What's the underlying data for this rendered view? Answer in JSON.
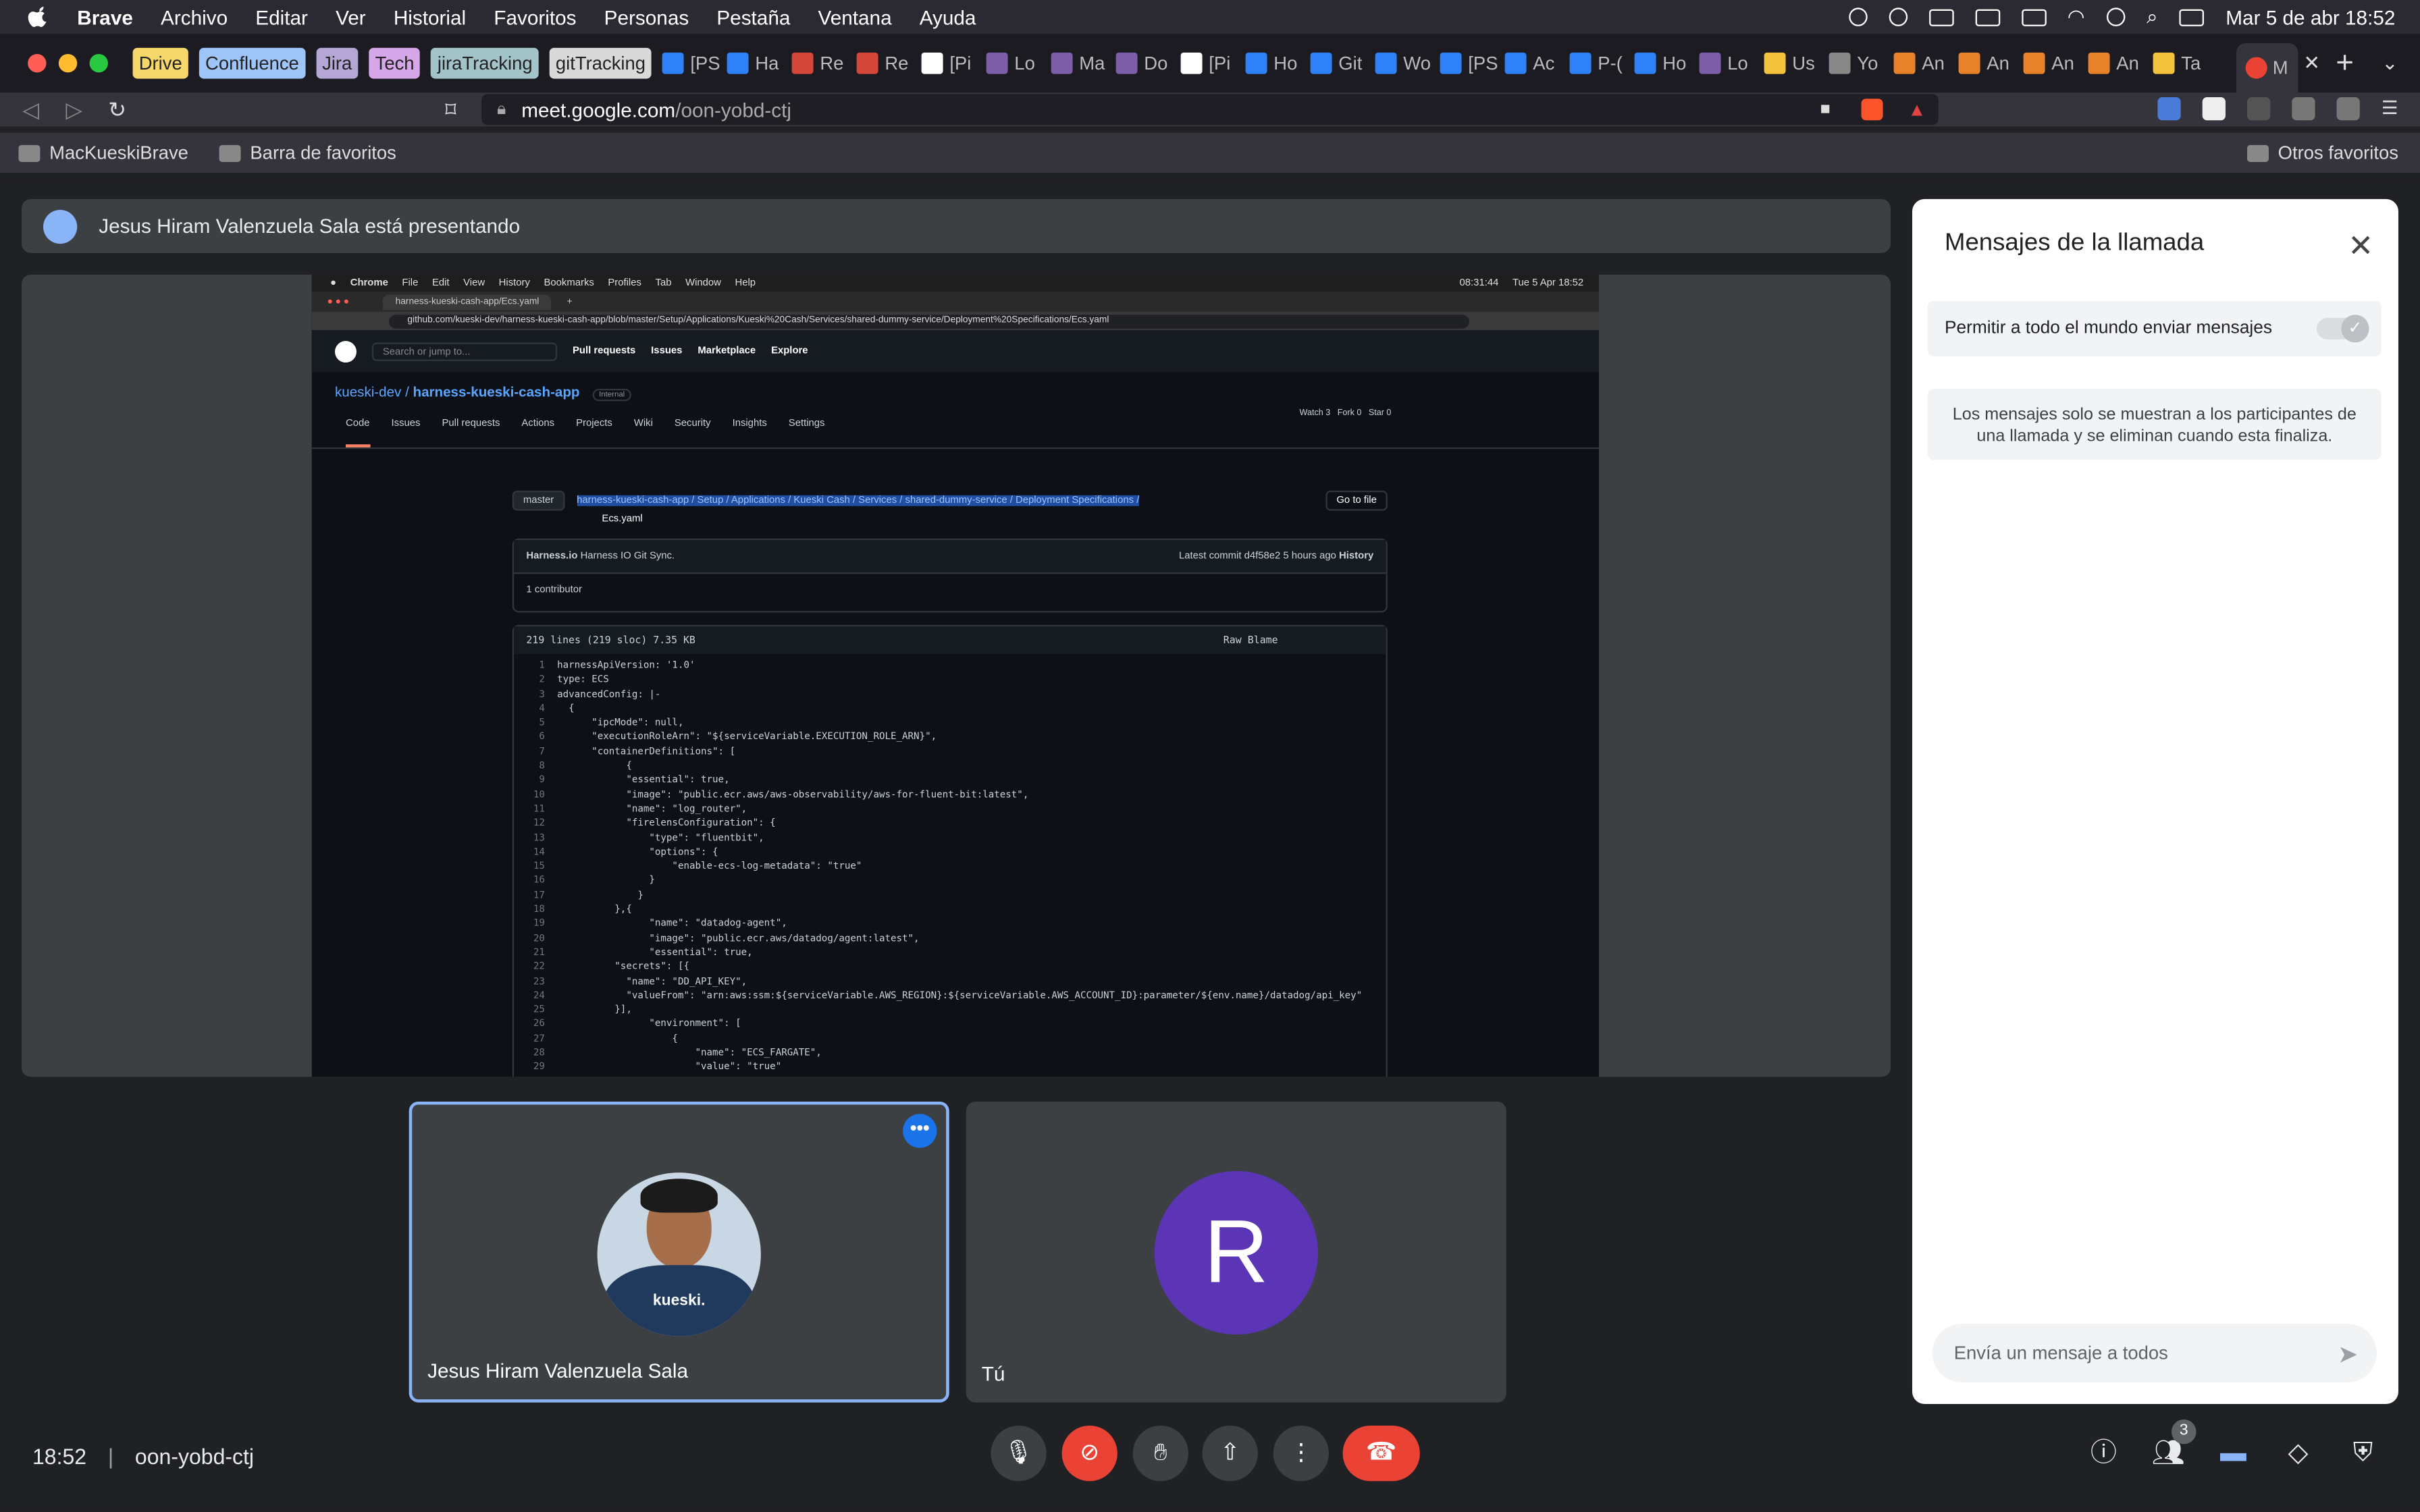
{
  "menubar": {
    "app": "Brave",
    "items": [
      "Archivo",
      "Editar",
      "Ver",
      "Historial",
      "Favoritos",
      "Personas",
      "Pestaña",
      "Ventana",
      "Ayuda"
    ],
    "datetime": "Mar 5 de abr  18:52"
  },
  "browser": {
    "bookmark_tabs": [
      {
        "label": "Drive",
        "color": "#f6d76b"
      },
      {
        "label": "Confluence",
        "color": "#9fc5f8"
      },
      {
        "label": "Jira",
        "color": "#b4a7d6"
      },
      {
        "label": "Tech",
        "color": "#d5a6e8"
      },
      {
        "label": "jiraTracking",
        "color": "#a2c4c9"
      },
      {
        "label": "gitTracking",
        "color": "#d9d9d9"
      }
    ],
    "tabs": [
      {
        "label": "[PS",
        "icon": "#2f81f7"
      },
      {
        "label": "Ha",
        "icon": "#2f81f7"
      },
      {
        "label": "Re",
        "icon": "#d44638"
      },
      {
        "label": "Re",
        "icon": "#d44638"
      },
      {
        "label": "[Pi",
        "icon": "#ffffff"
      },
      {
        "label": "Lo",
        "icon": "#7b5ea7"
      },
      {
        "label": "Ma",
        "icon": "#7b5ea7"
      },
      {
        "label": "Do",
        "icon": "#7b5ea7"
      },
      {
        "label": "[Pi",
        "icon": "#ffffff"
      },
      {
        "label": "Ho",
        "icon": "#2f81f7"
      },
      {
        "label": "Git",
        "icon": "#2f81f7"
      },
      {
        "label": "Wo",
        "icon": "#2f81f7"
      },
      {
        "label": "[PS",
        "icon": "#2f81f7"
      },
      {
        "label": "Ac",
        "icon": "#2f81f7"
      },
      {
        "label": "P-(",
        "icon": "#2f81f7"
      },
      {
        "label": "Ho",
        "icon": "#2f81f7"
      },
      {
        "label": "Lo",
        "icon": "#7b5ea7"
      },
      {
        "label": "Us",
        "icon": "#f5c33b"
      },
      {
        "label": "Yo",
        "icon": "#888888"
      },
      {
        "label": "An",
        "icon": "#e8822a"
      },
      {
        "label": "An",
        "icon": "#e8822a"
      },
      {
        "label": "An",
        "icon": "#e8822a"
      },
      {
        "label": "An",
        "icon": "#e8822a"
      },
      {
        "label": "Ta",
        "icon": "#f5c33b"
      }
    ],
    "active_tab_label": "M",
    "url_host": "meet.google.com",
    "url_path": "/oon-yobd-ctj",
    "bookmarks_bar": {
      "left": [
        "MacKueskiBrave",
        "Barra de favoritos"
      ],
      "right": "Otros favoritos"
    }
  },
  "meet": {
    "presenter_banner": "Jesus Hiram Valenzuela Sala está presentando",
    "participants": [
      {
        "name": "Jesus Hiram Valenzuela Sala",
        "shirt_text": "kueski."
      },
      {
        "name": "Tú",
        "initial": "R"
      }
    ],
    "time": "18:52",
    "meeting_code": "oon-yobd-ctj",
    "people_count": "3"
  },
  "shared_screen": {
    "menu": [
      "Chrome",
      "File",
      "Edit",
      "View",
      "History",
      "Bookmarks",
      "Profiles",
      "Tab",
      "Window",
      "Help"
    ],
    "clock": "Tue 5 Apr  18:52",
    "timer": "08:31:44",
    "tab_title": "harness-kueski-cash-app/Ecs.yaml",
    "url": "github.com/kueski-dev/harness-kueski-cash-app/blob/master/Setup/Applications/Kueski%20Cash/Services/shared-dummy-service/Deployment%20Specifications/Ecs.yaml",
    "gh_nav": [
      "Pull requests",
      "Issues",
      "Marketplace",
      "Explore"
    ],
    "gh_search": "Search or jump to...",
    "repo_owner": "kueski-dev",
    "repo_name": "harness-kueski-cash-app",
    "repo_badge": "Internal",
    "repo_tabs": [
      "Code",
      "Issues",
      "Pull requests",
      "Actions",
      "Projects",
      "Wiki",
      "Security",
      "Insights",
      "Settings"
    ],
    "repo_buttons": [
      "Watch  3",
      "Fork  0",
      "Star  0"
    ],
    "branch": "master",
    "path": "harness-kueski-cash-app / Setup / Applications / Kueski Cash / Services / shared-dummy-service / Deployment Specifications /",
    "file": "Ecs.yaml",
    "go_to_file": "Go to file",
    "commit_author": "Harness.io",
    "commit_msg": "Harness IO Git Sync.",
    "commit_meta": "Latest commit d4f58e2 5 hours ago",
    "history": "History",
    "contributors": "1 contributor",
    "file_info": "219 lines (219 sloc)   7.35 KB",
    "file_buttons": [
      "Raw",
      "Blame"
    ],
    "code_lines": [
      "harnessApiVersion: '1.0'",
      "type: ECS",
      "advancedConfig: |-",
      "  {",
      "      \"ipcMode\": null,",
      "      \"executionRoleArn\": \"${serviceVariable.EXECUTION_ROLE_ARN}\",",
      "      \"containerDefinitions\": [",
      "            {",
      "            \"essential\": true,",
      "            \"image\": \"public.ecr.aws/aws-observability/aws-for-fluent-bit:latest\",",
      "            \"name\": \"log_router\",",
      "            \"firelensConfiguration\": {",
      "                \"type\": \"fluentbit\",",
      "                \"options\": {",
      "                    \"enable-ecs-log-metadata\": \"true\"",
      "                }",
      "              }",
      "          },{",
      "                \"name\": \"datadog-agent\",",
      "                \"image\": \"public.ecr.aws/datadog/agent:latest\",",
      "                \"essential\": true,",
      "          \"secrets\": [{",
      "            \"name\": \"DD_API_KEY\",",
      "            \"valueFrom\": \"arn:aws:ssm:${serviceVariable.AWS_REGION}:${serviceVariable.AWS_ACCOUNT_ID}:parameter/${env.name}/datadog/api_key\"",
      "          }],",
      "                \"environment\": [",
      "                    {",
      "                        \"name\": \"ECS_FARGATE\",",
      "                        \"value\": \"true\""
    ]
  },
  "chat_panel": {
    "title": "Mensajes de la llamada",
    "permission_label": "Permitir a todo el mundo enviar mensajes",
    "info": "Los mensajes solo se muestran a los participantes de una llamada y se eliminan cuando esta finaliza.",
    "input_placeholder": "Envía un mensaje a todos"
  }
}
